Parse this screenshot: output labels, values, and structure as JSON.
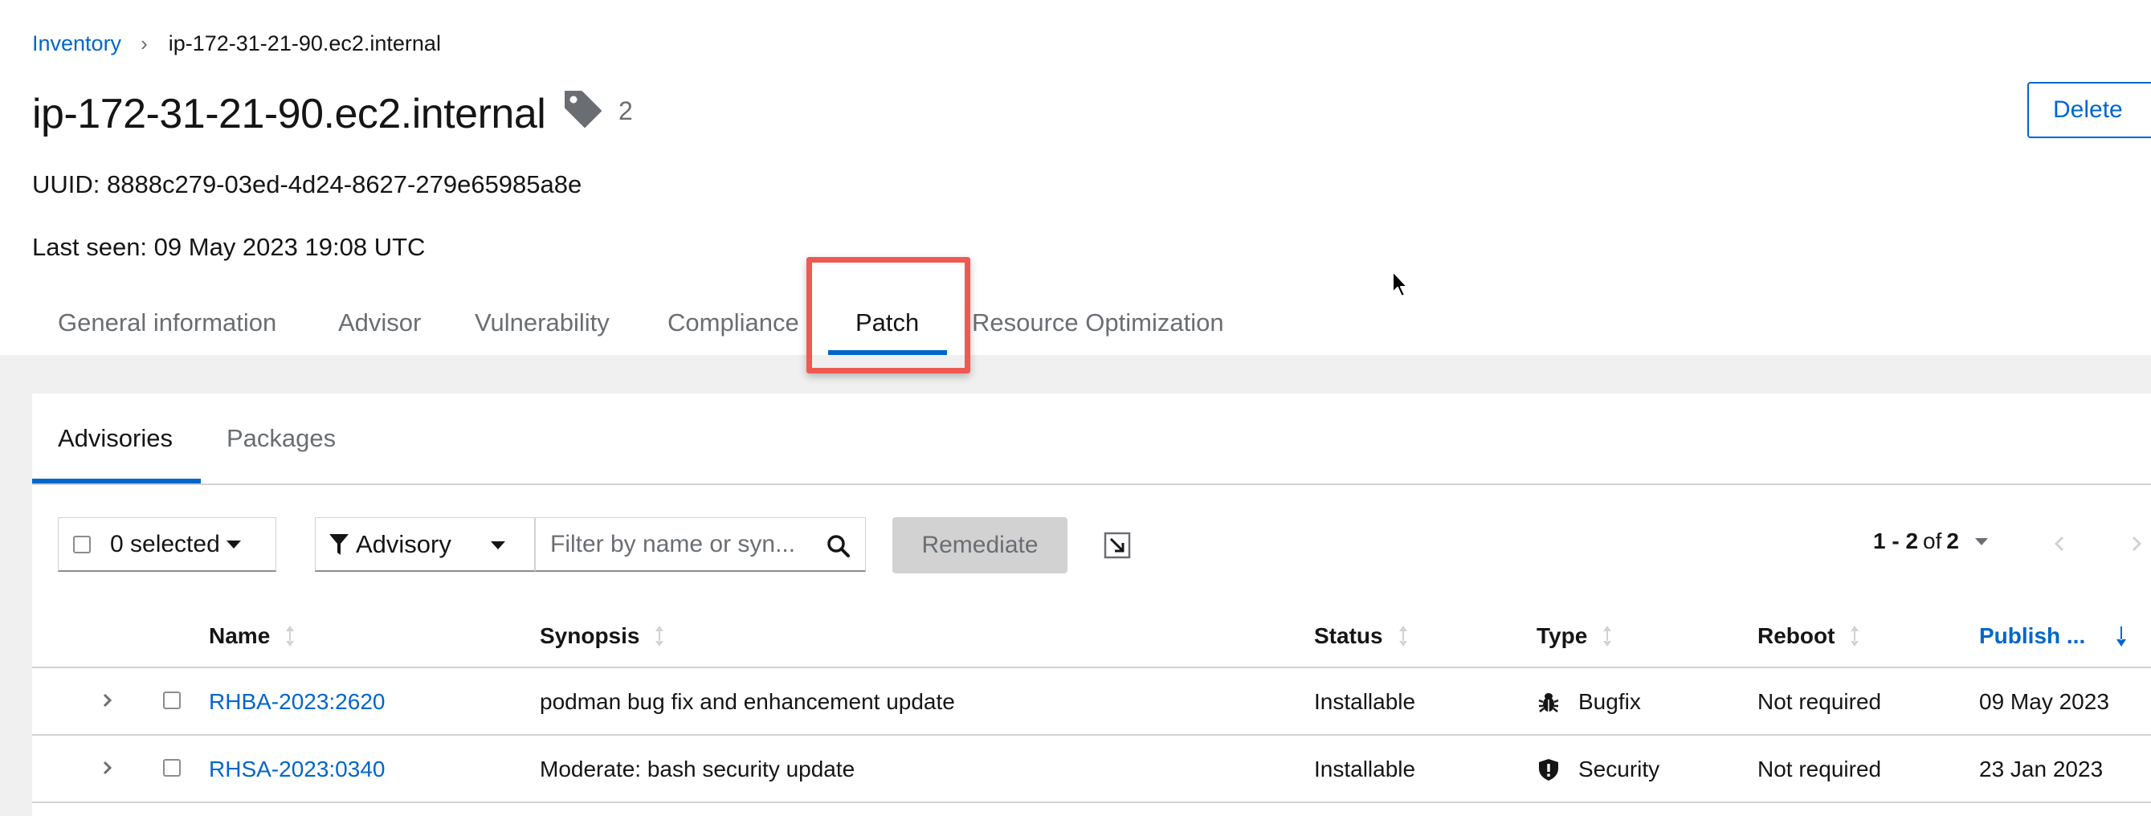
{
  "breadcrumb": {
    "parent": "Inventory",
    "current": "ip-172-31-21-90.ec2.internal"
  },
  "header": {
    "title": "ip-172-31-21-90.ec2.internal",
    "tag_count": "2",
    "delete_label": "Delete",
    "uuid_text": "UUID: 8888c279-03ed-4d24-8627-279e65985a8e",
    "last_seen_text": "Last seen: 09 May 2023 19:08 UTC"
  },
  "main_tabs": [
    {
      "label": "General information",
      "active": false
    },
    {
      "label": "Advisor",
      "active": false
    },
    {
      "label": "Vulnerability",
      "active": false
    },
    {
      "label": "Compliance",
      "active": false
    },
    {
      "label": "Patch",
      "active": true
    },
    {
      "label": "Resource Optimization",
      "active": false
    }
  ],
  "sub_tabs": [
    {
      "label": "Advisories",
      "active": true
    },
    {
      "label": "Packages",
      "active": false
    }
  ],
  "toolbar": {
    "bulk_select_label": "0 selected",
    "filter_type_label": "Advisory",
    "search_placeholder": "Filter by name or syn...",
    "remediate_label": "Remediate",
    "pagination": {
      "range": "1 - 2",
      "of": "of",
      "total": "2"
    }
  },
  "table": {
    "columns": [
      "Name",
      "Synopsis",
      "Status",
      "Type",
      "Reboot",
      "Publish ..."
    ],
    "sorted_column": "Publish ...",
    "rows": [
      {
        "name": "RHBA-2023:2620",
        "synopsis": "podman bug fix and enhancement update",
        "status": "Installable",
        "type": "Bugfix",
        "type_icon": "bug-icon",
        "reboot": "Not required",
        "publish_date": "09 May 2023"
      },
      {
        "name": "RHSA-2023:0340",
        "synopsis": "Moderate: bash security update",
        "status": "Installable",
        "type": "Security",
        "type_icon": "shield-icon",
        "reboot": "Not required",
        "publish_date": "23 Jan 2023"
      }
    ]
  },
  "colors": {
    "link": "#0066cc",
    "highlight_box": "#ee5a52",
    "content_background": "#f0f0f0"
  }
}
